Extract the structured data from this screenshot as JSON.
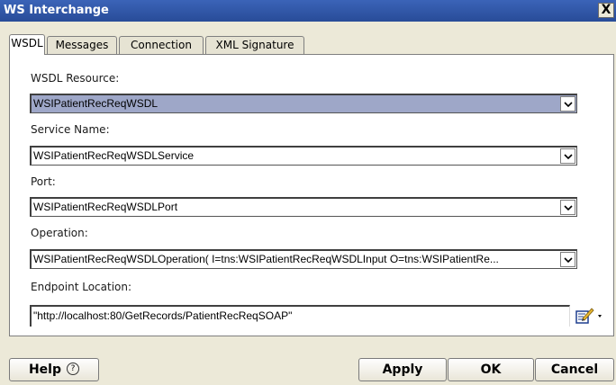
{
  "window": {
    "title": "WS Interchange",
    "close_label": "X"
  },
  "tabs": [
    {
      "label": "WSDL"
    },
    {
      "label": "Messages"
    },
    {
      "label": "Connection"
    },
    {
      "label": "XML Signature"
    }
  ],
  "fields": {
    "wsdl_resource": {
      "label": "WSDL Resource:",
      "value": "WSIPatientRecReqWSDL"
    },
    "service_name": {
      "label": "Service Name:",
      "value": "WSIPatientRecReqWSDLService"
    },
    "port": {
      "label": "Port:",
      "value": "WSIPatientRecReqWSDLPort"
    },
    "operation": {
      "label": "Operation:",
      "value": "WSIPatientRecReqWSDLOperation( I=tns:WSIPatientRecReqWSDLInput O=tns:WSIPatientRe..."
    },
    "endpoint_location": {
      "label": "Endpoint Location:",
      "value": "\"http://localhost:80/GetRecords/PatientRecReqSOAP\""
    }
  },
  "buttons": {
    "help": "Help",
    "help_glyph": "?",
    "apply": "Apply",
    "ok": "OK",
    "cancel": "Cancel"
  },
  "colors": {
    "titlebar": "#2d54a5",
    "selected_field": "#9ea7c8"
  }
}
